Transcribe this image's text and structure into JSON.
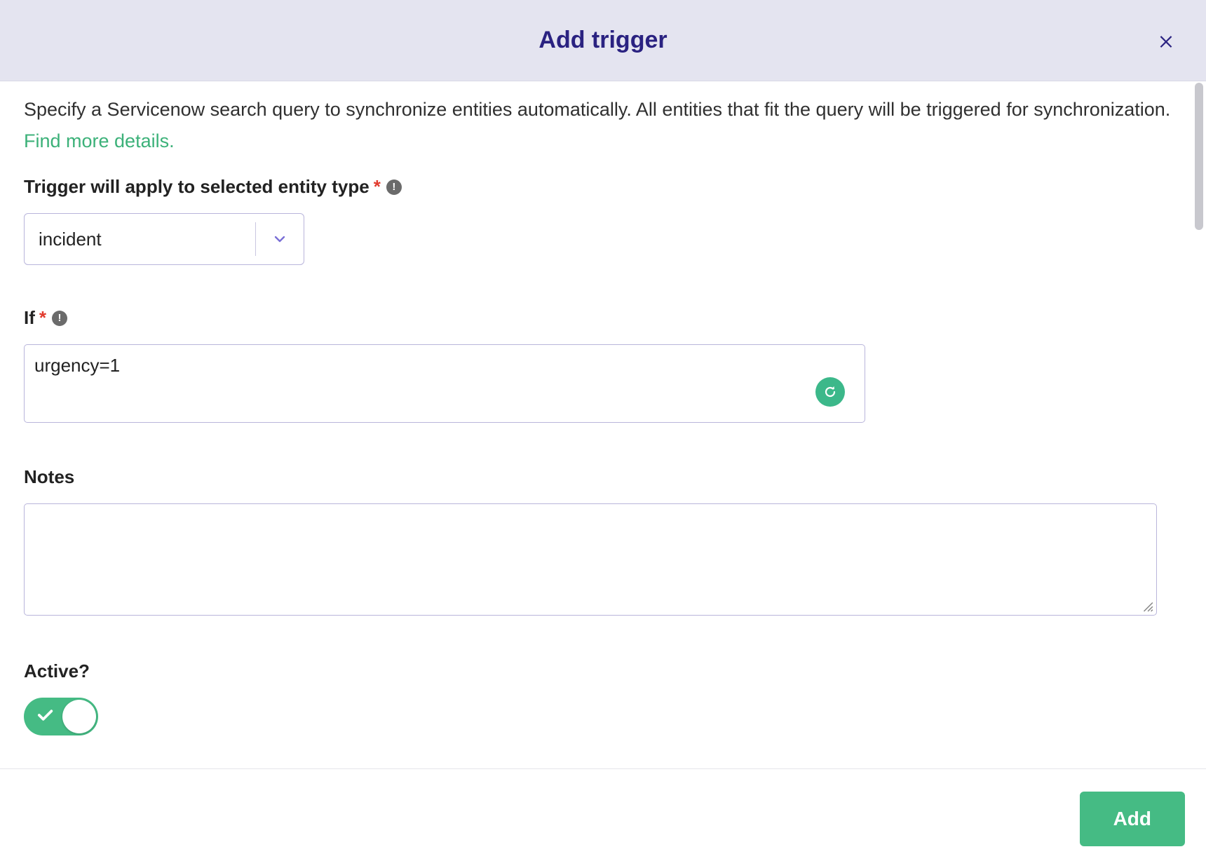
{
  "header": {
    "title": "Add trigger"
  },
  "description": {
    "text": "Specify a Servicenow search query to synchronize entities automatically. All entities that fit the query will be triggered for synchronization. ",
    "link_text": "Find more details."
  },
  "entity_type": {
    "label": "Trigger will apply to selected entity type",
    "value": "incident"
  },
  "if_field": {
    "label": "If",
    "value": "urgency=1"
  },
  "notes": {
    "label": "Notes",
    "value": ""
  },
  "active": {
    "label": "Active?",
    "value": true
  },
  "footer": {
    "add_label": "Add"
  }
}
